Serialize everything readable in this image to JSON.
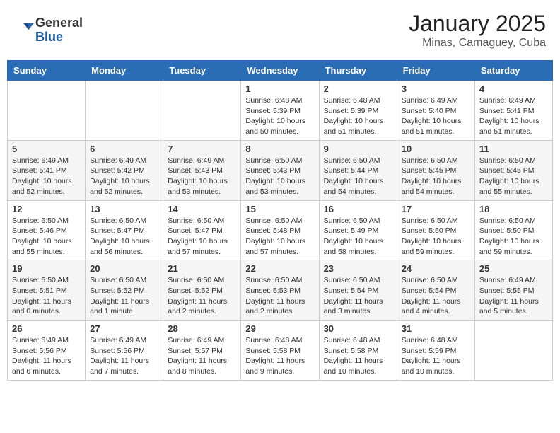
{
  "header": {
    "logo_general": "General",
    "logo_blue": "Blue",
    "month_title": "January 2025",
    "location": "Minas, Camaguey, Cuba"
  },
  "days_of_week": [
    "Sunday",
    "Monday",
    "Tuesday",
    "Wednesday",
    "Thursday",
    "Friday",
    "Saturday"
  ],
  "weeks": [
    [
      {
        "day": "",
        "info": ""
      },
      {
        "day": "",
        "info": ""
      },
      {
        "day": "",
        "info": ""
      },
      {
        "day": "1",
        "info": "Sunrise: 6:48 AM\nSunset: 5:39 PM\nDaylight: 10 hours\nand 50 minutes."
      },
      {
        "day": "2",
        "info": "Sunrise: 6:48 AM\nSunset: 5:39 PM\nDaylight: 10 hours\nand 51 minutes."
      },
      {
        "day": "3",
        "info": "Sunrise: 6:49 AM\nSunset: 5:40 PM\nDaylight: 10 hours\nand 51 minutes."
      },
      {
        "day": "4",
        "info": "Sunrise: 6:49 AM\nSunset: 5:41 PM\nDaylight: 10 hours\nand 51 minutes."
      }
    ],
    [
      {
        "day": "5",
        "info": "Sunrise: 6:49 AM\nSunset: 5:41 PM\nDaylight: 10 hours\nand 52 minutes."
      },
      {
        "day": "6",
        "info": "Sunrise: 6:49 AM\nSunset: 5:42 PM\nDaylight: 10 hours\nand 52 minutes."
      },
      {
        "day": "7",
        "info": "Sunrise: 6:49 AM\nSunset: 5:43 PM\nDaylight: 10 hours\nand 53 minutes."
      },
      {
        "day": "8",
        "info": "Sunrise: 6:50 AM\nSunset: 5:43 PM\nDaylight: 10 hours\nand 53 minutes."
      },
      {
        "day": "9",
        "info": "Sunrise: 6:50 AM\nSunset: 5:44 PM\nDaylight: 10 hours\nand 54 minutes."
      },
      {
        "day": "10",
        "info": "Sunrise: 6:50 AM\nSunset: 5:45 PM\nDaylight: 10 hours\nand 54 minutes."
      },
      {
        "day": "11",
        "info": "Sunrise: 6:50 AM\nSunset: 5:45 PM\nDaylight: 10 hours\nand 55 minutes."
      }
    ],
    [
      {
        "day": "12",
        "info": "Sunrise: 6:50 AM\nSunset: 5:46 PM\nDaylight: 10 hours\nand 55 minutes."
      },
      {
        "day": "13",
        "info": "Sunrise: 6:50 AM\nSunset: 5:47 PM\nDaylight: 10 hours\nand 56 minutes."
      },
      {
        "day": "14",
        "info": "Sunrise: 6:50 AM\nSunset: 5:47 PM\nDaylight: 10 hours\nand 57 minutes."
      },
      {
        "day": "15",
        "info": "Sunrise: 6:50 AM\nSunset: 5:48 PM\nDaylight: 10 hours\nand 57 minutes."
      },
      {
        "day": "16",
        "info": "Sunrise: 6:50 AM\nSunset: 5:49 PM\nDaylight: 10 hours\nand 58 minutes."
      },
      {
        "day": "17",
        "info": "Sunrise: 6:50 AM\nSunset: 5:50 PM\nDaylight: 10 hours\nand 59 minutes."
      },
      {
        "day": "18",
        "info": "Sunrise: 6:50 AM\nSunset: 5:50 PM\nDaylight: 10 hours\nand 59 minutes."
      }
    ],
    [
      {
        "day": "19",
        "info": "Sunrise: 6:50 AM\nSunset: 5:51 PM\nDaylight: 11 hours\nand 0 minutes."
      },
      {
        "day": "20",
        "info": "Sunrise: 6:50 AM\nSunset: 5:52 PM\nDaylight: 11 hours\nand 1 minute."
      },
      {
        "day": "21",
        "info": "Sunrise: 6:50 AM\nSunset: 5:52 PM\nDaylight: 11 hours\nand 2 minutes."
      },
      {
        "day": "22",
        "info": "Sunrise: 6:50 AM\nSunset: 5:53 PM\nDaylight: 11 hours\nand 2 minutes."
      },
      {
        "day": "23",
        "info": "Sunrise: 6:50 AM\nSunset: 5:54 PM\nDaylight: 11 hours\nand 3 minutes."
      },
      {
        "day": "24",
        "info": "Sunrise: 6:50 AM\nSunset: 5:54 PM\nDaylight: 11 hours\nand 4 minutes."
      },
      {
        "day": "25",
        "info": "Sunrise: 6:49 AM\nSunset: 5:55 PM\nDaylight: 11 hours\nand 5 minutes."
      }
    ],
    [
      {
        "day": "26",
        "info": "Sunrise: 6:49 AM\nSunset: 5:56 PM\nDaylight: 11 hours\nand 6 minutes."
      },
      {
        "day": "27",
        "info": "Sunrise: 6:49 AM\nSunset: 5:56 PM\nDaylight: 11 hours\nand 7 minutes."
      },
      {
        "day": "28",
        "info": "Sunrise: 6:49 AM\nSunset: 5:57 PM\nDaylight: 11 hours\nand 8 minutes."
      },
      {
        "day": "29",
        "info": "Sunrise: 6:48 AM\nSunset: 5:58 PM\nDaylight: 11 hours\nand 9 minutes."
      },
      {
        "day": "30",
        "info": "Sunrise: 6:48 AM\nSunset: 5:58 PM\nDaylight: 11 hours\nand 10 minutes."
      },
      {
        "day": "31",
        "info": "Sunrise: 6:48 AM\nSunset: 5:59 PM\nDaylight: 11 hours\nand 10 minutes."
      },
      {
        "day": "",
        "info": ""
      }
    ]
  ]
}
